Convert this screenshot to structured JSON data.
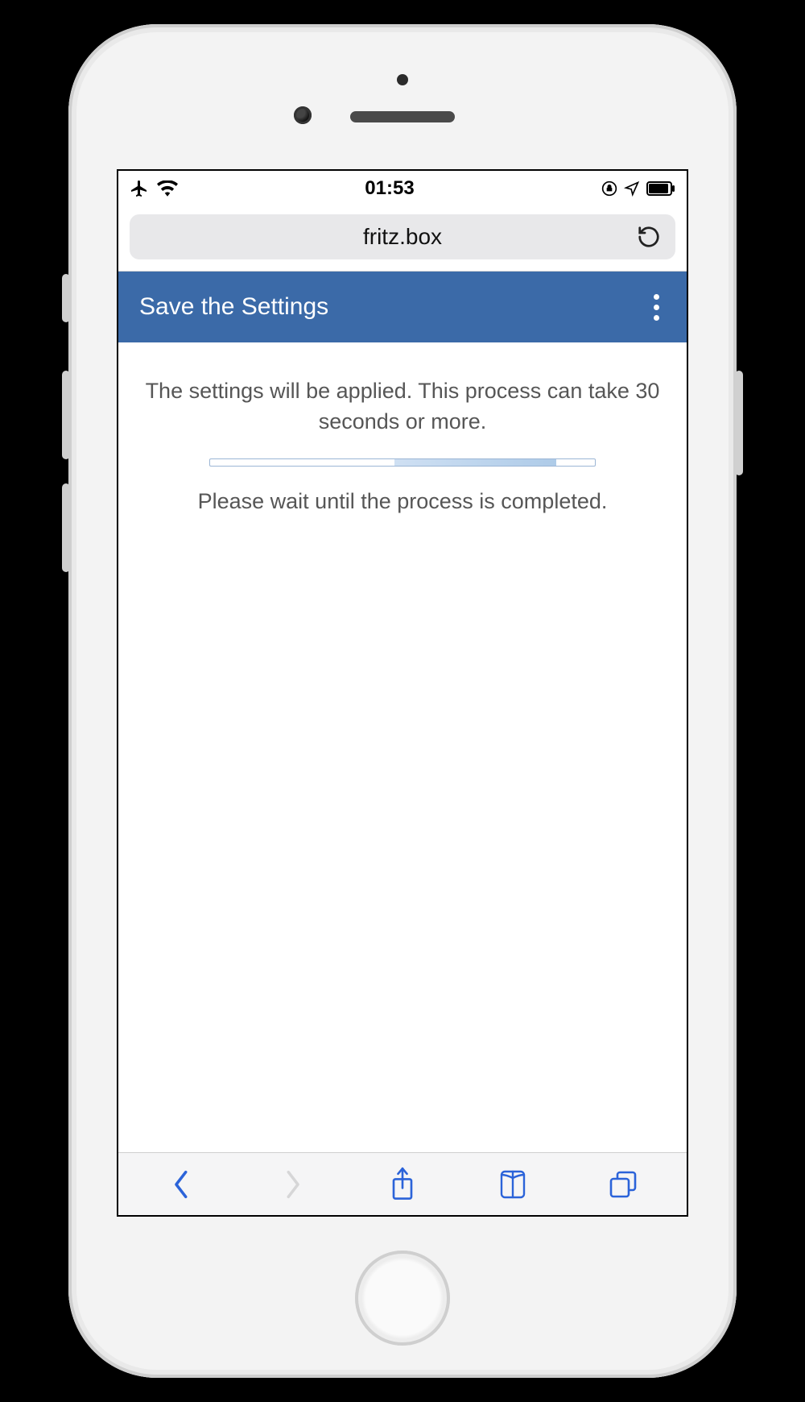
{
  "status_bar": {
    "time": "01:53"
  },
  "browser": {
    "address": "fritz.box"
  },
  "app": {
    "header_title": "Save the Settings"
  },
  "content": {
    "message_primary": "The settings will be applied. This process can take 30 seconds or more.",
    "message_secondary": "Please wait until the process is completed."
  },
  "colors": {
    "header_bg": "#3b6aa8",
    "ios_blue": "#2b63d9"
  }
}
